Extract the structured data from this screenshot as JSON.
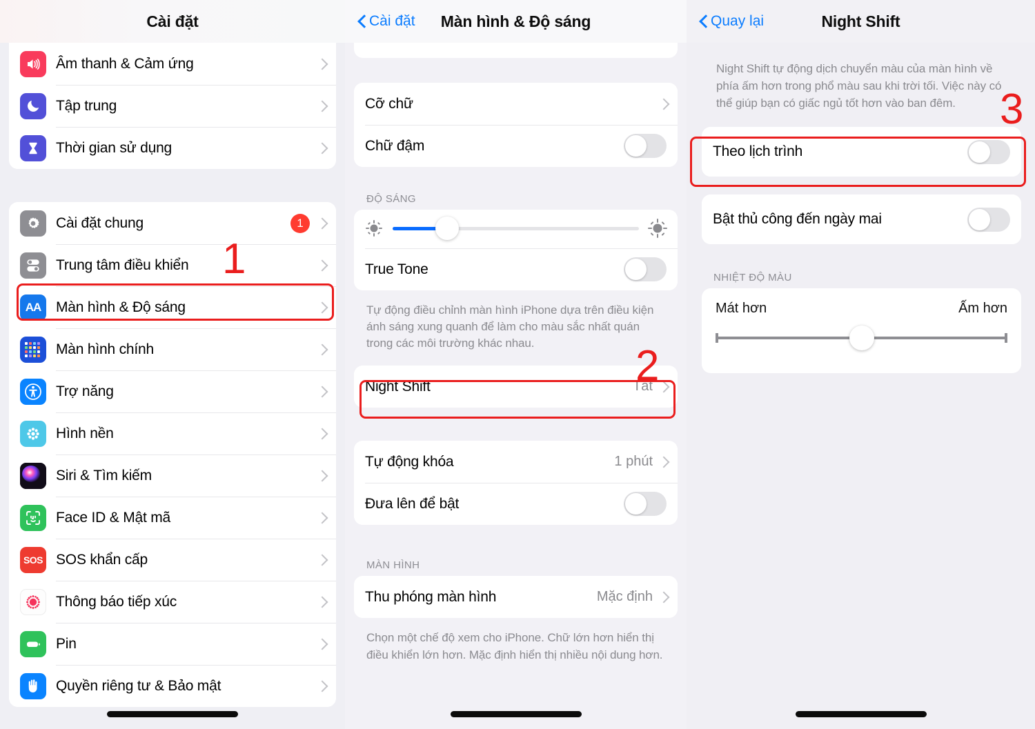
{
  "annotations": {
    "one": "1",
    "two": "2",
    "three": "3",
    "color": "#ea1d1d"
  },
  "settings_screen": {
    "title": "Cài đặt",
    "group1": [
      {
        "label": "Âm thanh & Cảm ứng",
        "icon": "speaker-icon"
      },
      {
        "label": "Tập trung",
        "icon": "moon-icon"
      },
      {
        "label": "Thời gian sử dụng",
        "icon": "hourglass-icon"
      }
    ],
    "group2": [
      {
        "label": "Cài đặt chung",
        "icon": "gear-icon",
        "badge": "1"
      },
      {
        "label": "Trung tâm điều khiển",
        "icon": "control-center-icon"
      },
      {
        "label": "Màn hình & Độ sáng",
        "icon": "display-aa-icon"
      },
      {
        "label": "Màn hình chính",
        "icon": "home-screen-icon"
      },
      {
        "label": "Trợ năng",
        "icon": "accessibility-icon"
      },
      {
        "label": "Hình nền",
        "icon": "wallpaper-icon"
      },
      {
        "label": "Siri & Tìm kiếm",
        "icon": "siri-icon"
      },
      {
        "label": "Face ID & Mật mã",
        "icon": "face-id-icon"
      },
      {
        "label": "SOS khẩn cấp",
        "icon": "sos-icon"
      },
      {
        "label": "Thông báo tiếp xúc",
        "icon": "exposure-notification-icon"
      },
      {
        "label": "Pin",
        "icon": "battery-icon"
      },
      {
        "label": "Quyền riêng tư & Bảo mật",
        "icon": "privacy-hand-icon"
      }
    ]
  },
  "display_screen": {
    "back_label": "Cài đặt",
    "title": "Màn hình & Độ sáng",
    "text_group": [
      {
        "label": "Cỡ chữ",
        "type": "link"
      },
      {
        "label": "Chữ đậm",
        "type": "toggle",
        "on": false
      }
    ],
    "brightness_header": "ĐỘ SÁNG",
    "brightness_value": 22,
    "true_tone": {
      "label": "True Tone",
      "on": false
    },
    "true_tone_footnote": "Tự động điều chỉnh màn hình iPhone dựa trên điều kiện ánh sáng xung quanh để làm cho màu sắc nhất quán trong các môi trường khác nhau.",
    "night_shift": {
      "label": "Night Shift",
      "value": "Tắt"
    },
    "lock_group": [
      {
        "label": "Tự động khóa",
        "value": "1 phút",
        "type": "link"
      },
      {
        "label": "Đưa lên để bật",
        "type": "toggle",
        "on": false
      }
    ],
    "display_header": "MÀN HÌNH",
    "zoom_row": {
      "label": "Thu phóng màn hình",
      "value": "Mặc định"
    },
    "zoom_footnote": "Chọn một chế độ xem cho iPhone. Chữ lớn hơn hiển thị điều khiển lớn hơn. Mặc định hiển thị nhiều nội dung hơn."
  },
  "night_shift_screen": {
    "back_label": "Quay lại",
    "title": "Night Shift",
    "description": "Night Shift tự động dịch chuyển màu của màn hình về phía ấm hơn trong phổ màu sau khi trời tối. Việc này có thể giúp bạn có giấc ngủ tốt hơn vào ban đêm.",
    "scheduled": {
      "label": "Theo lịch trình",
      "on": false
    },
    "manual": {
      "label": "Bật thủ công đến ngày mai",
      "on": false
    },
    "temp_header": "NHIỆT ĐỘ MÀU",
    "temp_left": "Mát hơn",
    "temp_right": "Ấm hơn",
    "temp_value": 50
  }
}
